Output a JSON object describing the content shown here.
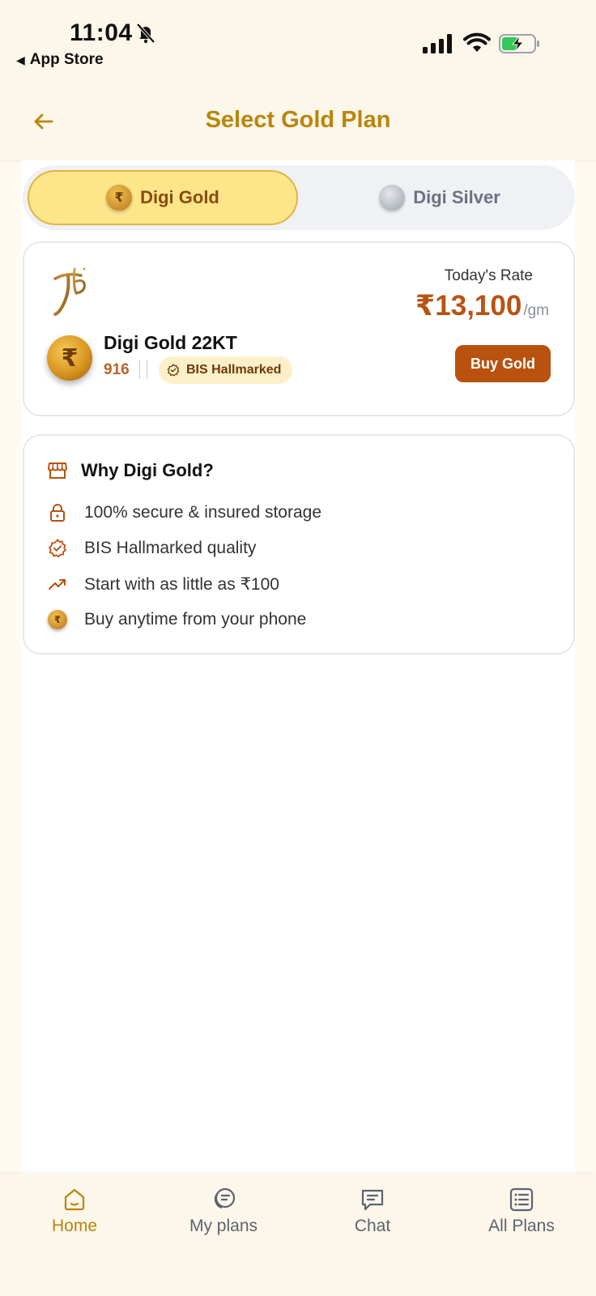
{
  "status_bar": {
    "time": "11:04",
    "back_label": "App Store"
  },
  "header": {
    "title": "Select Gold Plan"
  },
  "toggle": {
    "gold_label": "Digi Gold",
    "silver_label": "Digi Silver",
    "selected": "Digi Gold"
  },
  "gold_card": {
    "rate_label": "Today's Rate",
    "rate_value": "₹13,100",
    "rate_unit": "/gm",
    "product_name": "Digi Gold 22KT",
    "purity": "916",
    "badge": "BIS Hallmarked",
    "buy_label": "Buy Gold",
    "coin_symbol": "₹"
  },
  "why_card": {
    "title": "Why Digi Gold?",
    "items": [
      {
        "icon": "lock-icon",
        "label": "100% secure & insured storage"
      },
      {
        "icon": "badge-check-icon",
        "label": "BIS Hallmarked quality"
      },
      {
        "icon": "trending-up-icon",
        "label": "Start with as little as ₹100"
      },
      {
        "icon": "gold-coin-icon",
        "label": "Buy anytime from your phone"
      }
    ]
  },
  "bottom_nav": {
    "items": [
      {
        "icon": "home-icon",
        "label": "Home",
        "active": true
      },
      {
        "icon": "my-plans-icon",
        "label": "My plans",
        "active": false
      },
      {
        "icon": "chat-icon",
        "label": "Chat",
        "active": false
      },
      {
        "icon": "list-icon",
        "label": "All Plans",
        "active": false
      }
    ]
  },
  "colors": {
    "accent_gold": "#b8860b",
    "button_brown": "#b8520e",
    "toggle_active_bg": "#fde68a",
    "background": "#fffaf2"
  }
}
